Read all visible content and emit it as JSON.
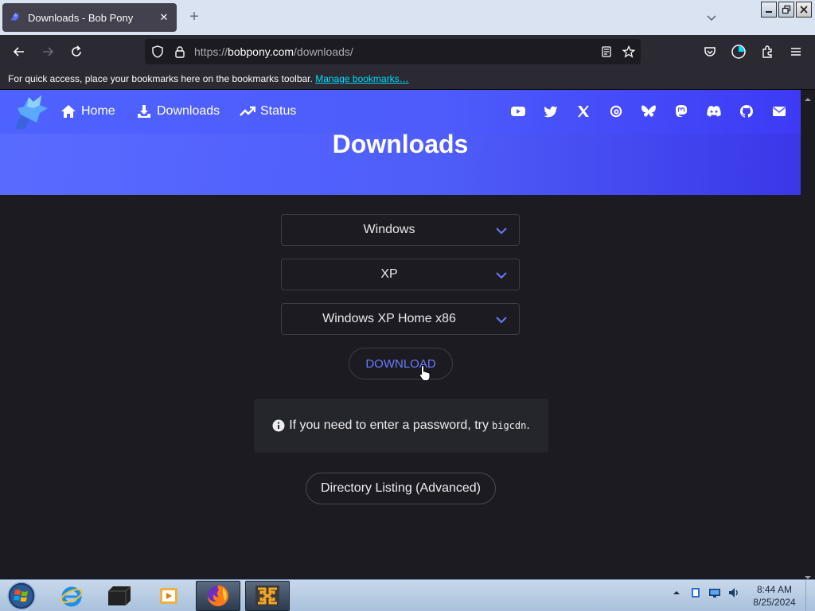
{
  "browser": {
    "tab": {
      "title": "Downloads - Bob Pony",
      "favicon": "bobpony-favicon"
    },
    "new_tab_label": "+",
    "url": {
      "prefix": "https://",
      "domain": "bobpony.com",
      "path": "/downloads/"
    },
    "bookmarks_bar": {
      "text": "For quick access, place your bookmarks here on the bookmarks toolbar.",
      "link": "Manage bookmarks…"
    }
  },
  "site": {
    "nav": [
      {
        "label": "Home",
        "icon": "home-icon"
      },
      {
        "label": "Downloads",
        "icon": "download-icon"
      },
      {
        "label": "Status",
        "icon": "trending-icon"
      }
    ],
    "socials": [
      "youtube-icon",
      "twitter-icon",
      "x-icon",
      "threads-icon",
      "bluesky-icon",
      "mastodon-icon",
      "discord-icon",
      "github-icon",
      "mail-icon"
    ],
    "title": "Downloads"
  },
  "form": {
    "os": "Windows",
    "version": "XP",
    "edition": "Windows XP Home x86",
    "download_label": "DOWNLOAD",
    "notice_text": "If you need to enter a password, try",
    "notice_code": "bigcdn",
    "notice_end": ".",
    "directory_label": "Directory Listing (Advanced)"
  },
  "taskbar": {
    "apps": [
      "internet-explorer-icon",
      "terminal-icon",
      "media-player-icon",
      "firefox-icon",
      "vmware-icon"
    ],
    "time": "8:44 AM",
    "date": "8/25/2024"
  },
  "colors": {
    "hero_start": "#4e62ff",
    "hero_end": "#3d3af5",
    "accent": "#6b7bff",
    "page_bg": "#1c1b22"
  }
}
